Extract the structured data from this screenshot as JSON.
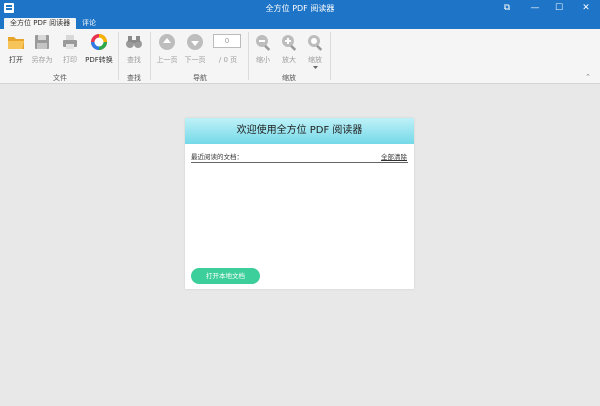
{
  "window": {
    "title": "全方位 PDF 阅读器",
    "controls": {
      "pin": "⧉",
      "minimize": "—",
      "maximize": "☐",
      "close": "✕"
    }
  },
  "tabs": [
    {
      "label": "全方位 PDF 阅读器",
      "active": true
    },
    {
      "label": "评论",
      "active": false
    }
  ],
  "ribbon": {
    "file": {
      "open": "打开",
      "save_as": "另存为",
      "print": "打印",
      "pdf_convert": "PDF转换",
      "group": "文件"
    },
    "find": {
      "find": "查找",
      "group": "查找"
    },
    "nav": {
      "prev": "上一页",
      "next": "下一页",
      "page_value": "0",
      "page_total": "/ 0 页",
      "group": "导航"
    },
    "zoom": {
      "zoom_out": "缩小",
      "zoom_in": "放大",
      "zoom": "缩放",
      "group": "缩放"
    },
    "collapse": "⌃"
  },
  "welcome": {
    "title": "欢迎使用全方位 PDF 阅读器",
    "recent_label": "最近阅读的文档：",
    "clear_all": "全部清除",
    "open_local": "打开本地文档"
  },
  "colors": {
    "titlebar": "#1e74c6",
    "header_gradient_top": "#bff1f8",
    "header_gradient_bottom": "#74d9e8",
    "open_button": "#3dcf9b"
  }
}
